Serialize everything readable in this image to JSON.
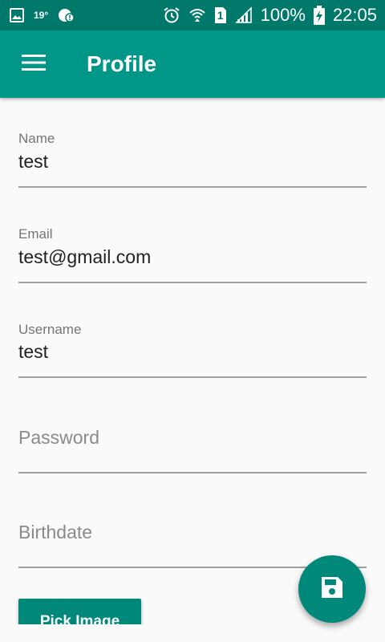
{
  "status_bar": {
    "temperature": "19°",
    "battery_percent": "100%",
    "time": "22:05",
    "sim_number": "1",
    "icons": [
      "image-icon",
      "weather-icon",
      "sync-error-icon",
      "alarm-icon",
      "wifi-icon",
      "sim-icon",
      "signal-icon",
      "battery-charging-icon"
    ]
  },
  "app_bar": {
    "title": "Profile",
    "menu_icon": "menu-icon"
  },
  "form": {
    "name": {
      "label": "Name",
      "value": "test"
    },
    "email": {
      "label": "Email",
      "value": "test@gmail.com"
    },
    "username": {
      "label": "Username",
      "value": "test"
    },
    "password": {
      "placeholder": "Password"
    },
    "birthdate": {
      "placeholder": "Birthdate"
    }
  },
  "pick_image_label": "Pick Image",
  "fab": {
    "icon": "save-icon"
  },
  "colors": {
    "status_bar": "#00796b",
    "app_bar": "#009688",
    "accent": "#00897b",
    "background": "#fafafa"
  }
}
